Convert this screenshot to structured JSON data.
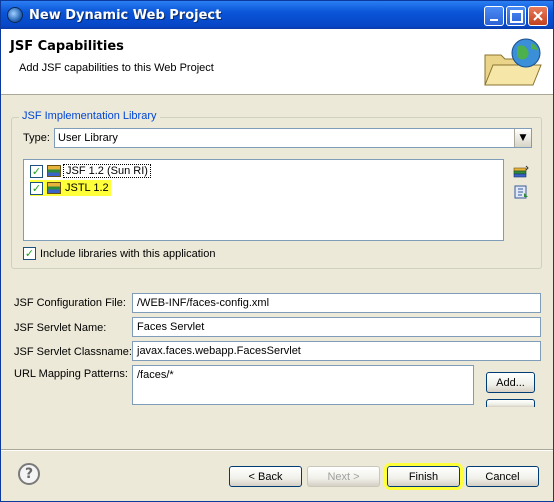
{
  "window": {
    "title": "New Dynamic Web Project"
  },
  "header": {
    "title": "JSF Capabilities",
    "description": "Add JSF capabilities to this Web Project"
  },
  "implementation_group": {
    "legend": "JSF Implementation Library",
    "type_label": "Type:",
    "type_value": "User Library",
    "libraries": [
      {
        "label": "JSF 1.2 (Sun RI)",
        "checked": true
      },
      {
        "label": "JSTL 1.2",
        "checked": true
      }
    ],
    "include_label": "Include libraries with this application",
    "include_checked": true
  },
  "fields": {
    "config_label": "JSF Configuration File:",
    "config_value": "/WEB-INF/faces-config.xml",
    "servlet_name_label": "JSF Servlet Name:",
    "servlet_name_value": "Faces Servlet",
    "servlet_class_label": "JSF Servlet Classname:",
    "servlet_class_value": "javax.faces.webapp.FacesServlet",
    "url_label": "URL Mapping Patterns:",
    "url_value": "/faces/*",
    "add_label": "Add..."
  },
  "footer": {
    "back_label": "< Back",
    "next_label": "Next >",
    "finish_label": "Finish",
    "cancel_label": "Cancel",
    "help_label": "?"
  },
  "colors": {
    "highlight": "#ffff3a",
    "titlebar": "#0a55d8",
    "window_bg": "#ece9d8"
  }
}
